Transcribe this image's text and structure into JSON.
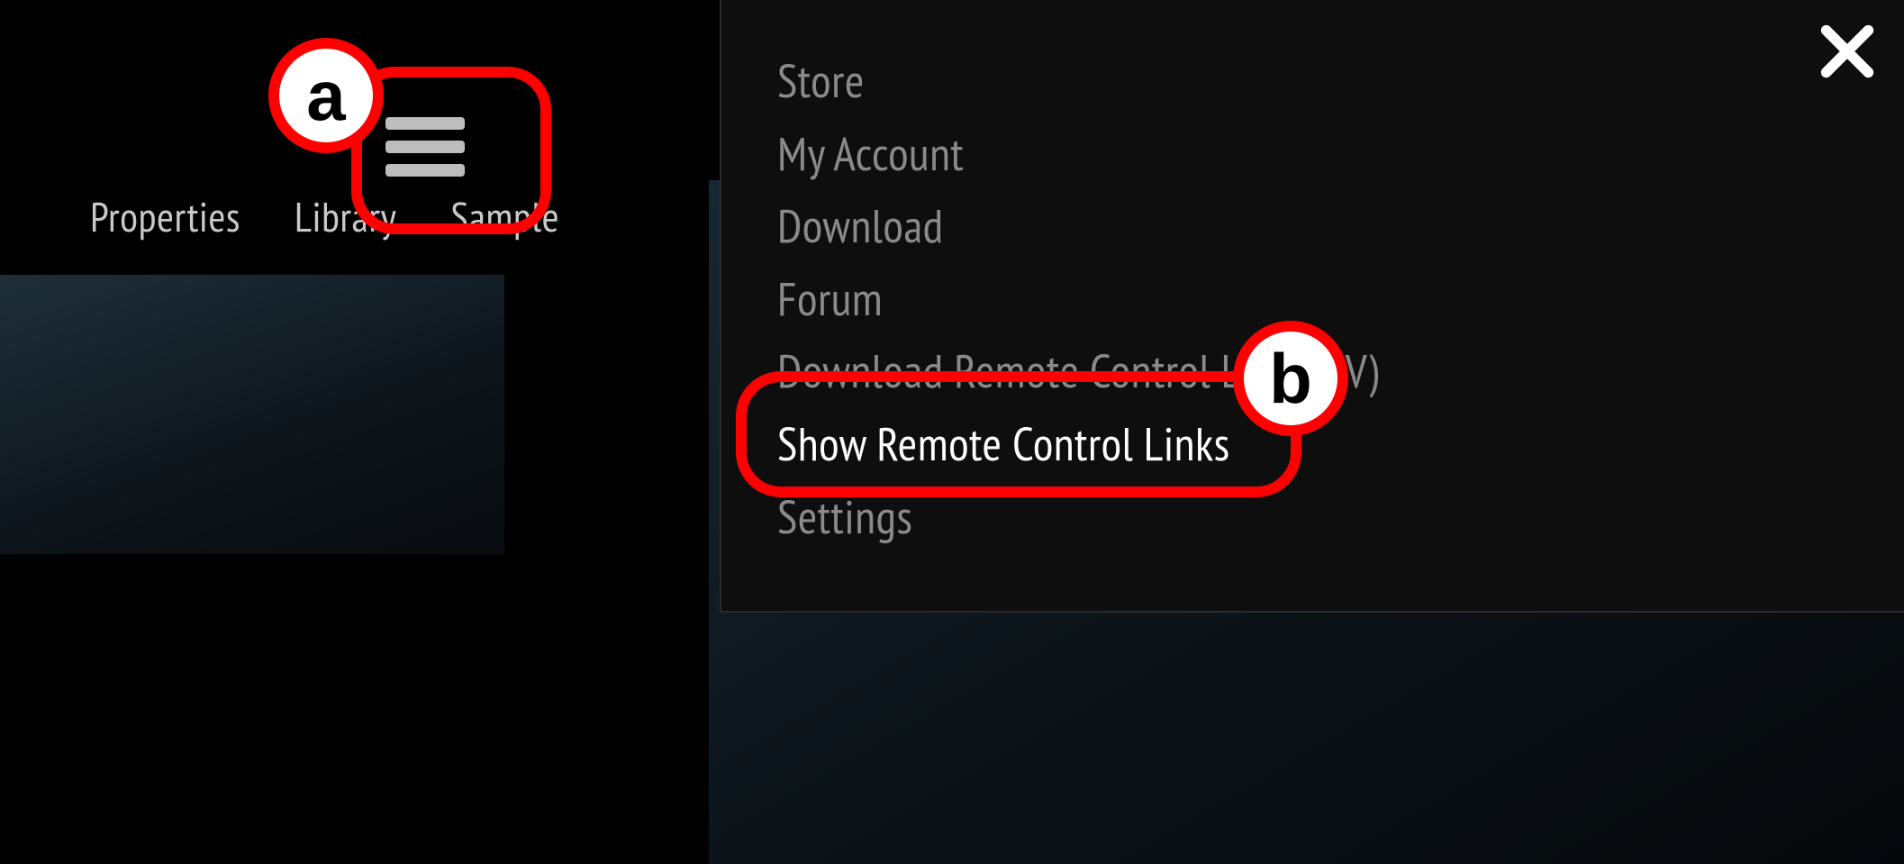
{
  "left": {
    "tabs": [
      "Properties",
      "Library",
      "Sample"
    ]
  },
  "menu": {
    "items": [
      "Store",
      "My Account",
      "Download",
      "Forum",
      "Download Remote Control List (CSV)",
      "Show Remote Control Links",
      "Settings"
    ],
    "activeIndex": 5
  },
  "annotations": {
    "a": "a",
    "b": "b"
  },
  "colors": {
    "highlight": "#ff0000",
    "menuInactive": "#8a8a8a",
    "menuActive": "#ffffff"
  }
}
